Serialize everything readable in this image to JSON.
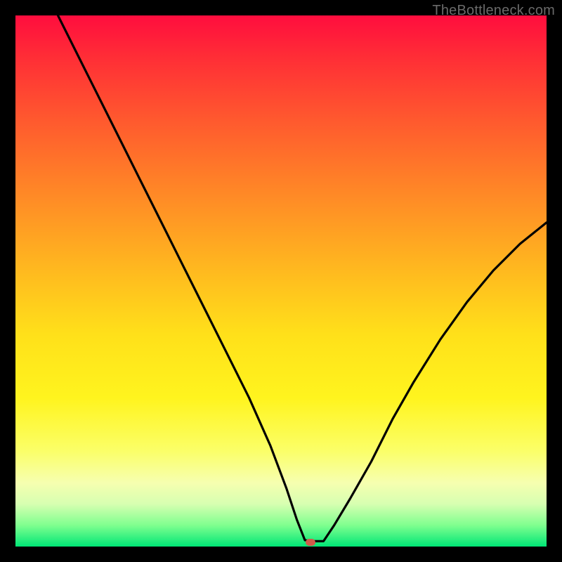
{
  "watermark": "TheBottleneck.com",
  "colors": {
    "background": "#000000",
    "curve": "#000000",
    "marker": "#cf5b4a",
    "watermark": "#6a6a6a"
  },
  "marker": {
    "x_pct": 55.5,
    "y_pct": 99.2
  },
  "chart_data": {
    "type": "line",
    "title": "",
    "xlabel": "",
    "ylabel": "",
    "xlim": [
      0,
      100
    ],
    "ylim": [
      0,
      100
    ],
    "legend": false,
    "grid": false,
    "annotations": [],
    "series": [
      {
        "name": "bottleneck-curve",
        "x": [
          8,
          12,
          16,
          20,
          24,
          28,
          32,
          36,
          40,
          44,
          48,
          51,
          53,
          54.5,
          56,
          58,
          60,
          63,
          67,
          71,
          75,
          80,
          85,
          90,
          95,
          100
        ],
        "y": [
          100,
          92,
          84,
          76,
          68,
          60,
          52,
          44,
          36,
          28,
          19,
          11,
          5,
          1.2,
          1,
          1,
          4,
          9,
          16,
          24,
          31,
          39,
          46,
          52,
          57,
          61
        ]
      }
    ],
    "markers": [
      {
        "name": "min-point",
        "x": 55.5,
        "y": 0.8
      }
    ]
  }
}
